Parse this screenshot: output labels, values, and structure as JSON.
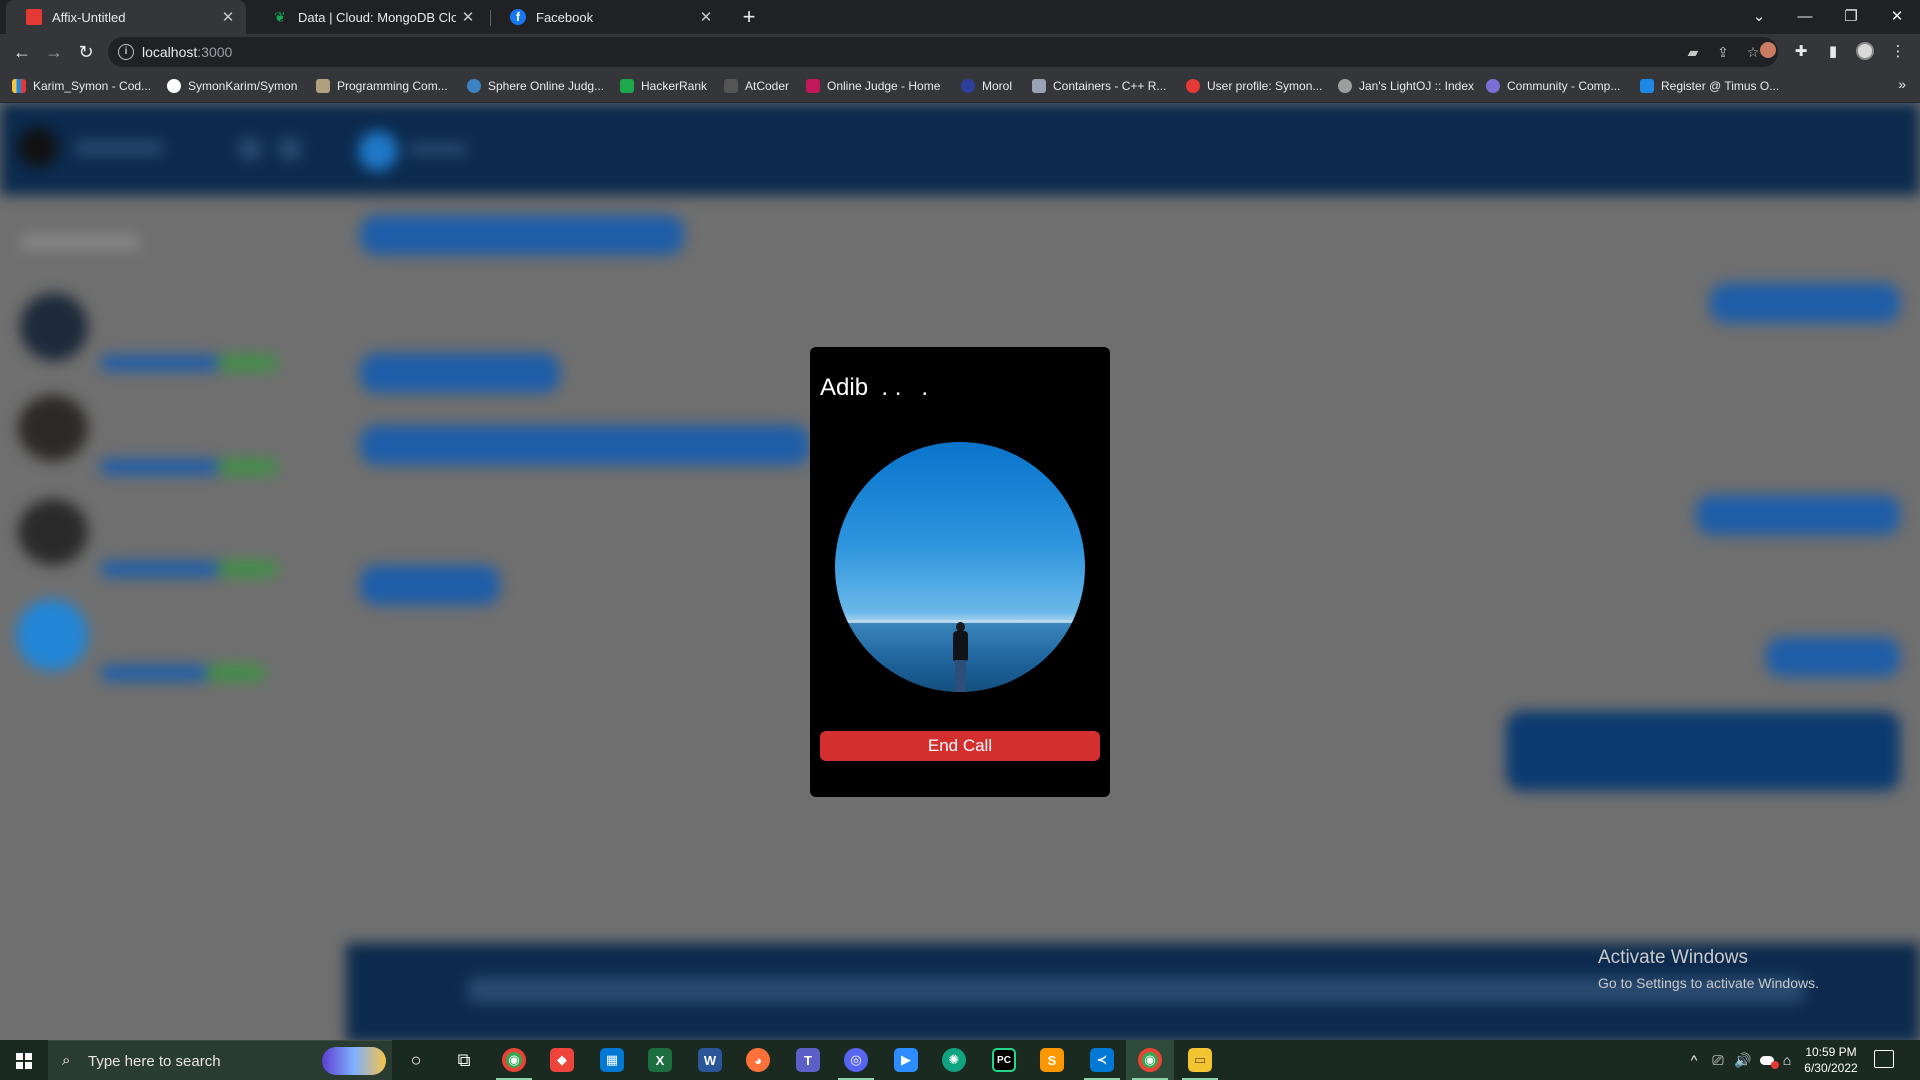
{
  "browser": {
    "tabs": [
      {
        "title": "Affix-Untitled",
        "favicon_color": "#e53935",
        "active": true
      },
      {
        "title": "Data | Cloud: MongoDB Cloud",
        "favicon_color": "#13aa52",
        "active": false
      },
      {
        "title": "Facebook",
        "favicon_color": "#1877f2",
        "active": false
      }
    ],
    "new_tab_label": "+",
    "close_glyph": "✕",
    "window_controls": {
      "tabsearch": "⌄",
      "minimize": "—",
      "restore": "❐",
      "close": "✕"
    },
    "nav": {
      "back": "←",
      "forward": "→",
      "reload": "↻"
    },
    "url_host": "localhost",
    "url_port": ":3000",
    "info_icon": "i",
    "bookmarks": [
      {
        "label": "Karim_Symon - Cod...",
        "icon": "codeforces-icon",
        "color": "#f5c542"
      },
      {
        "label": "SymonKarim/Symon",
        "icon": "github-icon",
        "color": "#ffffff"
      },
      {
        "label": "Programming Com...",
        "icon": "codechef-icon",
        "color": "#b0a080"
      },
      {
        "label": "Sphere Online Judg...",
        "icon": "spoj-icon",
        "color": "#3b82c4"
      },
      {
        "label": "HackerRank",
        "icon": "hackerrank-icon",
        "color": "#1ba94c"
      },
      {
        "label": "AtCoder",
        "icon": "atcoder-icon",
        "color": "#888888"
      },
      {
        "label": "Online Judge - Home",
        "icon": "uva-icon",
        "color": "#c2185b"
      },
      {
        "label": "Morol",
        "icon": "morol-icon",
        "color": "#2c3e9e"
      },
      {
        "label": "Containers - C++ R...",
        "icon": "cppreference-icon",
        "color": "#9aa3b5"
      },
      {
        "label": "User profile: Symon...",
        "icon": "timus-profile-icon",
        "color": "#e53935"
      },
      {
        "label": "Jan's LightOJ :: Index",
        "icon": "lightoj-icon",
        "color": "#9e9e9e"
      },
      {
        "label": "Community - Comp...",
        "icon": "community-icon",
        "color": "#7b6fd6"
      },
      {
        "label": "Register @ Timus O...",
        "icon": "timus-icon",
        "color": "#1e88e5"
      }
    ],
    "bookmarks_more": "»"
  },
  "call": {
    "caller_name": "Adib  . .   .",
    "end_call_label": "End Call"
  },
  "watermark": {
    "title": "Activate Windows",
    "subtitle": "Go to Settings to activate Windows."
  },
  "taskbar": {
    "search_placeholder": "Type here to search",
    "search_icon": "⌕",
    "apps": [
      {
        "name": "cortana-icon",
        "glyph": "○",
        "color": "transparent"
      },
      {
        "name": "task-view-icon",
        "glyph": "⧉",
        "color": "transparent"
      },
      {
        "name": "chrome-icon",
        "glyph": "◉",
        "color": "#34a853"
      },
      {
        "name": "anydesk-icon",
        "glyph": "◆",
        "color": "#ef443b"
      },
      {
        "name": "store-icon",
        "glyph": "▦",
        "color": "#0078d4"
      },
      {
        "name": "excel-icon",
        "glyph": "X",
        "color": "#1d6f42"
      },
      {
        "name": "word-icon",
        "glyph": "W",
        "color": "#2b579a"
      },
      {
        "name": "firefox-icon",
        "glyph": "◕",
        "color": "#ff7139"
      },
      {
        "name": "teams-icon",
        "glyph": "T",
        "color": "#5b5fc7"
      },
      {
        "name": "discord-icon",
        "glyph": "◎",
        "color": "#5865f2"
      },
      {
        "name": "zoom-icon",
        "glyph": "▶",
        "color": "#2d8cff"
      },
      {
        "name": "chatgpt-icon",
        "glyph": "✺",
        "color": "#10a37f"
      },
      {
        "name": "pycharm-icon",
        "glyph": "PC",
        "color": "#21d789"
      },
      {
        "name": "sublime-icon",
        "glyph": "S",
        "color": "#ff9800"
      },
      {
        "name": "vscode-icon",
        "glyph": "≺",
        "color": "#0078d4"
      },
      {
        "name": "chrome-active-icon",
        "glyph": "◉",
        "color": "#34a853"
      },
      {
        "name": "file-explorer-icon",
        "glyph": "▭",
        "color": "#f4c430"
      }
    ],
    "tray": {
      "chevron": "^",
      "meet": "⎚",
      "volume": "🔊",
      "network": "⌂"
    },
    "time": "10:59 PM",
    "date": "6/30/2022"
  }
}
